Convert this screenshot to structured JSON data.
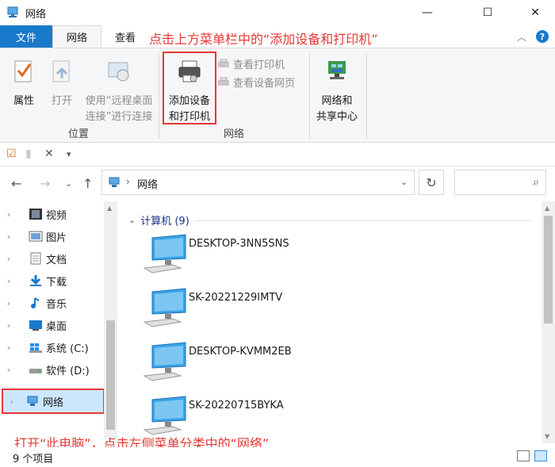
{
  "window": {
    "title": "网络",
    "minimize": "—",
    "maximize": "☐",
    "close": "✕"
  },
  "tabs": {
    "file": "文件",
    "network": "网络",
    "view": "查看"
  },
  "annotations": {
    "top": "点击上方菜单栏中的“添加设备和打印机”",
    "bottom": "打开“此电脑”，点击左侧菜单分类中的“网络”"
  },
  "ribbon": {
    "properties": "属性",
    "open": "打开",
    "remote_line1": "使用“远程桌面",
    "remote_line2": "连接”进行连接",
    "location_group": "位置",
    "add_line1": "添加设备",
    "add_line2": "和打印机",
    "view_printers": "查看打印机",
    "view_device_web": "查看设备网页",
    "network_group": "网络",
    "center_line1": "网络和",
    "center_line2": "共享中心"
  },
  "qat": {
    "dropdown": "▾"
  },
  "address": {
    "path": "网络",
    "separator": "›"
  },
  "nav": {
    "items": [
      {
        "label": "视频",
        "icon": "video-folder-icon"
      },
      {
        "label": "图片",
        "icon": "pictures-folder-icon"
      },
      {
        "label": "文档",
        "icon": "documents-folder-icon"
      },
      {
        "label": "下载",
        "icon": "downloads-folder-icon"
      },
      {
        "label": "音乐",
        "icon": "music-folder-icon"
      },
      {
        "label": "桌面",
        "icon": "desktop-folder-icon"
      },
      {
        "label": "系统 (C:)",
        "icon": "system-drive-icon"
      },
      {
        "label": "软件 (D:)",
        "icon": "drive-icon"
      }
    ],
    "network": "网络"
  },
  "content": {
    "group_title": "计算机 (9)",
    "computers": [
      "DESKTOP-3NN5SNS",
      "SK-20221229IMTV",
      "DESKTOP-KVMM2EB",
      "SK-20220715BYKA"
    ]
  },
  "status": {
    "count": "9 个项目"
  },
  "colors": {
    "accent": "#1979ca",
    "annotation": "#e53935",
    "selected": "#cce8ff"
  }
}
